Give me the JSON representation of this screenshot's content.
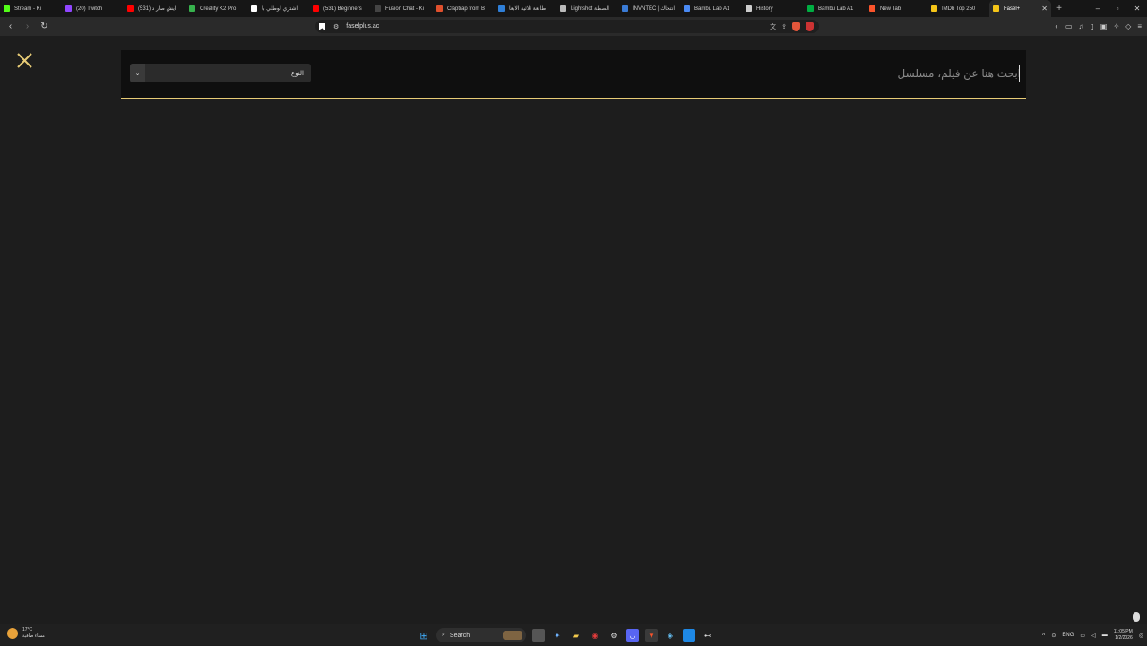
{
  "browser": {
    "tabs": [
      {
        "title": "Stream - Ki",
        "icon": "kick-icon",
        "color": "#53fc18"
      },
      {
        "title": "(20) Twitch",
        "icon": "twitch-icon",
        "color": "#9146ff"
      },
      {
        "title": "ايش صار د (531)",
        "icon": "youtube-icon",
        "color": "#ff0000"
      },
      {
        "title": "Creality K2 Pro",
        "icon": "creality-icon",
        "color": "#37b24d"
      },
      {
        "title": "اشتري لوطلي بأ",
        "icon": "page-icon",
        "color": "#ffffff"
      },
      {
        "title": "(531) Beginners",
        "icon": "youtube-icon",
        "color": "#ff0000"
      },
      {
        "title": "Fusion Chat - Ki",
        "icon": "fusion-icon",
        "color": "#444444"
      },
      {
        "title": "Claptrap from B",
        "icon": "claptrap-icon",
        "color": "#e0502d"
      },
      {
        "title": "طابعة ثلاثية الابعا",
        "icon": "doc-icon",
        "color": "#2f7fd8"
      },
      {
        "title": "Lightshot الصطة",
        "icon": "feather-icon",
        "color": "#bbbbbb"
      },
      {
        "title": "INVNTEC | انتحاك",
        "icon": "invntec-icon",
        "color": "#3a7bd5"
      },
      {
        "title": "Bambu Lab A1",
        "icon": "bambu-icon",
        "color": "#4a8af4"
      },
      {
        "title": "History",
        "icon": "history-icon",
        "color": "#cccccc"
      },
      {
        "title": "Bambu Lab A1",
        "icon": "bambu-icon",
        "color": "#00ae42"
      },
      {
        "title": "New Tab",
        "icon": "brave-icon",
        "color": "#fb542b"
      },
      {
        "title": "IMDb Top 250",
        "icon": "imdb-icon",
        "color": "#f5c518"
      },
      {
        "title": "Fasel+",
        "icon": "fasel-icon",
        "color": "#f5c518",
        "active": true
      }
    ],
    "new_tab_label": "+",
    "window_controls": {
      "minimize": "–",
      "maximize": "▫",
      "close": "✕"
    },
    "address": {
      "url": "faselplus.ac",
      "site_info_icon": "tune-icon"
    }
  },
  "page": {
    "search_placeholder": "ابحث هنا عن فيلم، مسلسل",
    "genre_select_value": "النوع",
    "accent_color": "#e7cb76"
  },
  "taskbar": {
    "weather_temp": "17°C",
    "weather_desc": "مساء صافية",
    "search_label": "Search",
    "language": "ENG",
    "time": "11:05 PM",
    "date": "1/2/2026"
  }
}
